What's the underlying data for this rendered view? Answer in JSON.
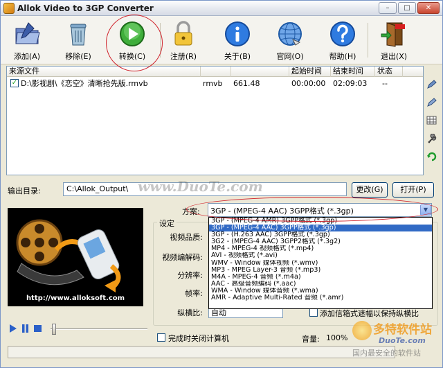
{
  "window": {
    "title": "Allok Video to 3GP Converter",
    "controls": [
      "–",
      "□",
      "✕"
    ]
  },
  "toolbar": {
    "items": [
      {
        "label": "添加(A)",
        "icon": "add-folder-icon"
      },
      {
        "label": "移除(E)",
        "icon": "trash-bin-icon"
      },
      {
        "label": "转换(C)",
        "icon": "play-convert-icon"
      },
      {
        "label": "注册(R)",
        "icon": "lock-icon"
      },
      {
        "label": "关于(B)",
        "icon": "info-icon"
      },
      {
        "label": "官网(O)",
        "icon": "globe-icon"
      },
      {
        "label": "帮助(H)",
        "icon": "help-icon"
      },
      {
        "label": "退出(X)",
        "icon": "exit-door-icon"
      }
    ]
  },
  "file_list": {
    "headers": [
      "来源文件",
      "",
      "",
      "起始时间",
      "结束时间",
      "状态"
    ],
    "rows": [
      {
        "checked": true,
        "path": "D:\\影视剧\\《恋空》清晰抢先版.rmvb",
        "format": "rmvb",
        "duration": "661.48",
        "start": "00:00:00",
        "end": "02:09:03",
        "status": "--"
      }
    ]
  },
  "side_tools": [
    "edit-pencil-icon",
    "edit-pencil-2-icon",
    "grid-icon",
    "wrench-icon",
    "refresh-arrow-icon"
  ],
  "output": {
    "label": "输出目录:",
    "path": "C:\\Allok_Output\\",
    "change_button": "更改(G)",
    "open_button": "打开(P)"
  },
  "preview": {
    "url": "http://www.alloksoft.com"
  },
  "player": {
    "buttons": [
      "play-icon",
      "pause-icon",
      "stop-icon"
    ]
  },
  "plan": {
    "label": "方案:",
    "selected": "3GP - (MPEG-4 AAC) 3GPP格式 (*.3gp)",
    "options": [
      "3GP - (MPEG-4 AMR) 3GPP格式 (*.3gp)",
      "3GP - (MPEG-4 AAC) 3GPP格式 (*.3gp)",
      "3GP - (H.263 AAC) 3GPP格式 (*.3gp)",
      "3G2 - (MPEG-4 AAC) 3GPP2格式 (*.3g2)",
      "MP4 - MPEG-4 视频格式 (*.mp4)",
      "AVI - 视频格式 (*.avi)",
      "WMV - Window 媒体视频 (*.wmv)",
      "MP3 - MPEG Layer-3 音频 (*.mp3)",
      "M4A - MPEG-4 音频 (*.m4a)",
      "AAC - 高级音频编码 (*.aac)",
      "WMA - Window 媒体音频 (*.wma)",
      "AMR - Adaptive Multi-Rated 音频 (*.amr)"
    ],
    "highlighted_index": 1
  },
  "settings": {
    "group_title": "设定",
    "labels": [
      "视频品质:",
      "视频编解码:",
      "分辨率:",
      "帧率:"
    ],
    "aspect_label": "纵横比:",
    "aspect_value": "自动",
    "letterbox_checkbox": "添加信箱式遮幅以保持纵横比"
  },
  "bottom": {
    "shutdown_checkbox": "完成时关闭计算机",
    "volume_label": "音量:",
    "volume_value": "100%"
  },
  "watermarks": {
    "center": "www.DuoTe.com",
    "corner_brand": "多特软件站",
    "corner_url": "DuoTe.com",
    "corner_slogan": "国内最安全的软件站"
  },
  "colors": {
    "annotation_red": "#d0232c",
    "selection_blue": "#316ac5",
    "window_bg": "#ece9d8"
  }
}
